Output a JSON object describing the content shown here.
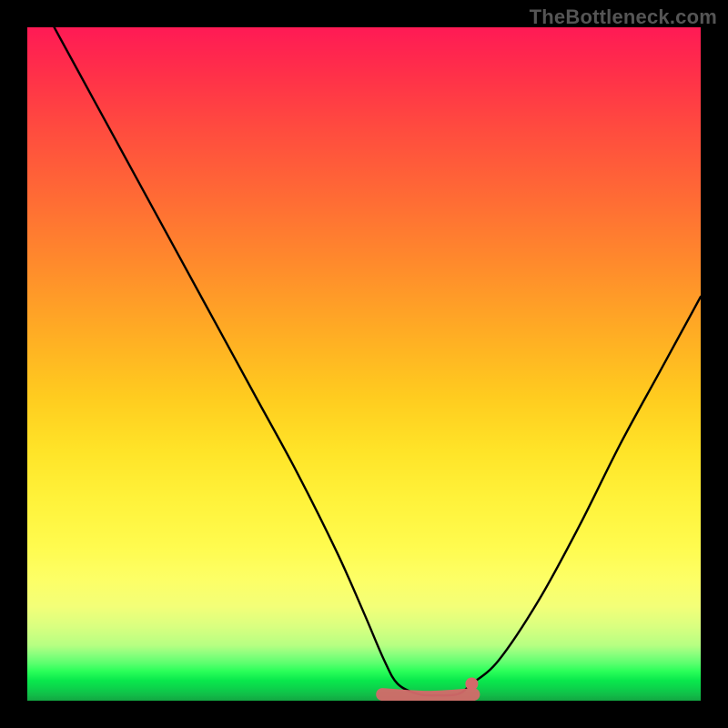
{
  "watermark": "TheBottleneck.com",
  "chart_data": {
    "type": "line",
    "title": "",
    "xlabel": "",
    "ylabel": "",
    "xlim": [
      0,
      100
    ],
    "ylim": [
      0,
      100
    ],
    "grid": false,
    "description": "Asymmetric V-shaped bottleneck curve on a vertical red-to-green gradient. Y represents bottleneck severity (top = high / red, bottom = zero / green). X is a hardware-pairing parameter. Curve is steeper on the left arm, shallower on the right, and flattens to ~0 over a short interval around x≈55–65.",
    "series": [
      {
        "name": "bottleneck-curve",
        "x": [
          4,
          10,
          16,
          22,
          28,
          34,
          40,
          46,
          50,
          53,
          55,
          58,
          61,
          64,
          66,
          70,
          76,
          82,
          88,
          94,
          100
        ],
        "y": [
          100,
          89,
          78,
          67,
          56,
          45,
          34,
          22,
          13,
          6,
          2.5,
          1,
          0.8,
          1,
          2.5,
          6,
          15,
          26,
          38,
          49,
          60
        ]
      }
    ],
    "optimal_region": {
      "x_start": 53,
      "x_end": 66,
      "y": 1.2
    },
    "marker_dot": {
      "x": 66,
      "y": 2.5
    },
    "gradient_stops": [
      {
        "pct": 0,
        "color": "#ff1a55"
      },
      {
        "pct": 25,
        "color": "#ff6a35"
      },
      {
        "pct": 55,
        "color": "#ffcc1f"
      },
      {
        "pct": 82,
        "color": "#fdff66"
      },
      {
        "pct": 95.6,
        "color": "#2cff5a"
      },
      {
        "pct": 100,
        "color": "#12a642"
      }
    ]
  }
}
